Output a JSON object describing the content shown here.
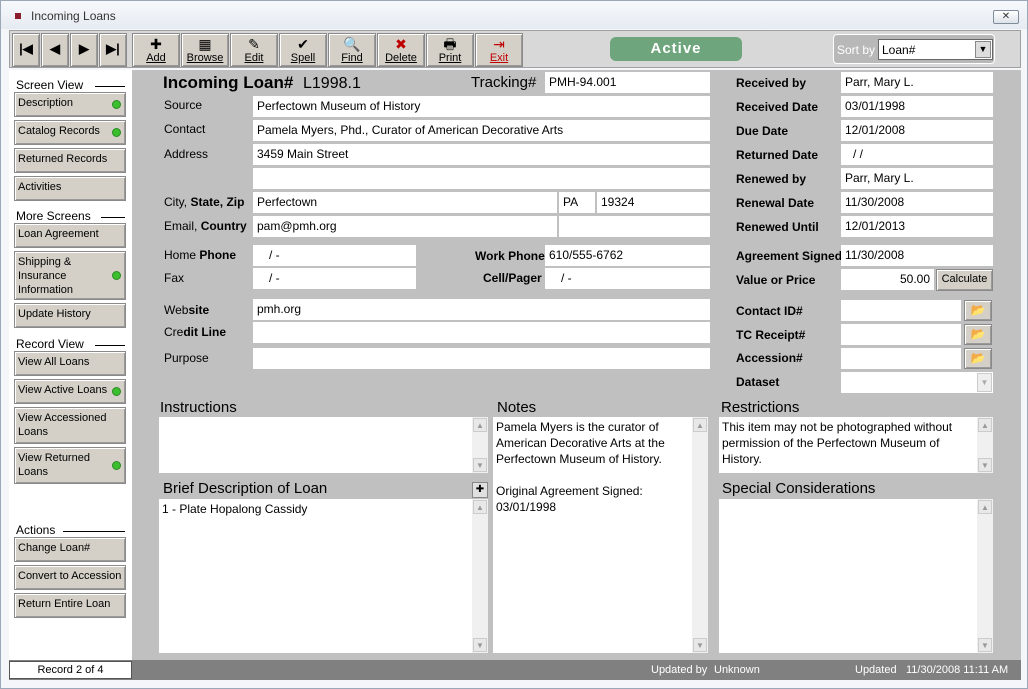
{
  "window": {
    "title": "Incoming Loans",
    "close_symbol": "✕"
  },
  "toolbar": {
    "nav": [
      {
        "name": "first",
        "glyph": "|◀"
      },
      {
        "name": "prev",
        "glyph": "◀"
      },
      {
        "name": "next",
        "glyph": "▶"
      },
      {
        "name": "last",
        "glyph": "▶|"
      }
    ],
    "actions": [
      {
        "label": "Add",
        "glyph": "✚"
      },
      {
        "label": "Browse",
        "glyph": "▦"
      },
      {
        "label": "Edit",
        "glyph": "✎"
      },
      {
        "label": "Spell",
        "glyph": "✔"
      },
      {
        "label": "Find",
        "glyph": "🔍"
      },
      {
        "label": "Delete",
        "glyph": "✖"
      },
      {
        "label": "Print",
        "glyph": "🖶"
      },
      {
        "label": "Exit",
        "glyph": "⇥"
      }
    ],
    "status": "Active",
    "sort_label": "Sort by",
    "sort_value": "Loan#",
    "sort_arrow": "▼"
  },
  "sidebar": {
    "screen_view_heading": "Screen View",
    "screen_view": [
      "Description",
      "Catalog Records",
      "Returned Records",
      "Activities"
    ],
    "more_screens_heading": "More Screens",
    "more_screens": [
      "Loan Agreement",
      "Shipping & Insurance Information",
      "Update History"
    ],
    "record_view_heading": "Record View",
    "record_view": [
      "View All Loans",
      "View Active Loans",
      "View Accessioned Loans",
      "View Returned Loans"
    ],
    "actions_heading": "Actions",
    "actions": [
      "Change Loan#",
      "Convert to Accession",
      "Return Entire Loan"
    ]
  },
  "form": {
    "loan_label": "Incoming Loan#",
    "loan_number": "L1998.1",
    "tracking_label": "Tracking#",
    "tracking": "PMH-94.001",
    "source_label": "Source",
    "source": "Perfectown Museum of History",
    "contact_label": "Contact",
    "contact": "Pamela Myers, Phd., Curator of American Decorative Arts",
    "address_label": "Address",
    "address1": "3459 Main Street",
    "address2": "",
    "city_label_a": "City,",
    "city_label_b": "State, Zip",
    "city": "Perfectown",
    "state": "PA",
    "zip": "19324",
    "email_label_a": "Email,",
    "email_label_b": "Country",
    "email": "pam@pmh.org",
    "country": "",
    "home_phone_label_a": "Home",
    "home_phone_label_b": "Phone",
    "home_phone": "/   -",
    "fax_label": "Fax",
    "fax": "/   -",
    "work_phone_label_a": "Work",
    "work_phone_label_b": "Phone",
    "work_phone": "610/555-6762",
    "cell_label": "Cell/Pager",
    "cell": "/   -",
    "website_label_a": "Web",
    "website_label_b": "site",
    "website": "pmh.org",
    "credit_label_a": "Cre",
    "credit_label_b": "dit Line",
    "credit_line": "",
    "purpose_label": "Purpose",
    "purpose": ""
  },
  "right_panel": {
    "received_by_label": "Received by",
    "received_by": "Parr, Mary L.",
    "received_date_label": "Received Date",
    "received_date": "03/01/1998",
    "due_date_label": "Due Date",
    "due_date": "12/01/2008",
    "returned_date_label": "Returned Date",
    "returned_date": "/  /",
    "renewed_by_label": "Renewed by",
    "renewed_by": "Parr, Mary L.",
    "renewal_date_label": "Renewal Date",
    "renewal_date": "11/30/2008",
    "renewed_until_label": "Renewed Until",
    "renewed_until": "12/01/2013",
    "agreement_signed_label": "Agreement Signed",
    "agreement_signed": "11/30/2008",
    "value_label": "Value or Price",
    "value": "50.00",
    "calculate_label": "Calculate",
    "contact_id_label": "Contact ID#",
    "contact_id": "",
    "tc_receipt_label": "TC Receipt#",
    "tc_receipt": "",
    "accession_label": "Accession#",
    "accession": "",
    "dataset_label": "Dataset",
    "dataset": "",
    "folder_glyph": "📂"
  },
  "memos": {
    "instructions_title": "Instructions",
    "instructions": "",
    "notes_title": "Notes",
    "notes_line1": "Pamela Myers is the curator of American Decorative Arts at the Perfectown Museum of History.",
    "notes_line2": "Original Agreement Signed: 03/01/1998",
    "restrictions_title": "Restrictions",
    "restrictions": "This item may not be photographed without permission of the Perfectown Museum of History.",
    "brief_title": "Brief Description of Loan",
    "brief": "1 - Plate Hopalong Cassidy",
    "brief_add_glyph": "✚",
    "special_title": "Special Considerations",
    "special": ""
  },
  "statusbar": {
    "record": "Record 2 of 4",
    "updated_by_label": "Updated by",
    "updated_by": "Unknown",
    "updated_label": "Updated",
    "updated": "11/30/2008 11:11 AM"
  },
  "scroll": {
    "up": "▲",
    "down": "▼"
  },
  "colors": {
    "active_badge": "#6ea57c",
    "status_dot": "#3bbf2e",
    "form_background": "#c0c0c0"
  }
}
